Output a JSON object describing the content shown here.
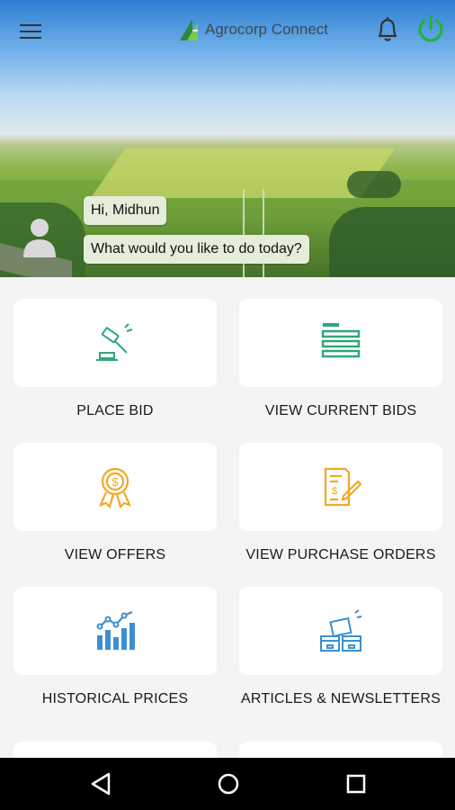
{
  "header": {
    "app_name": "Agrocorp Connect",
    "icons": [
      "menu-icon",
      "notification-bell-icon",
      "power-icon"
    ],
    "power_color": "#22b33a"
  },
  "greeting": {
    "hello": "Hi, Midhun",
    "question": "What would you like to do today?"
  },
  "menu": {
    "place_bid": "PLACE BID",
    "view_current_bids": "VIEW CURRENT BIDS",
    "view_offers": "VIEW OFFERS",
    "view_purchase_orders": "VIEW PURCHASE ORDERS",
    "historical_prices": "HISTORICAL PRICES",
    "articles_newsletters": "ARTICLES & NEWSLETTERS"
  },
  "colors": {
    "green_icon": "#2fa878",
    "orange_icon": "#f2a825",
    "blue_icon": "#3b8fd0"
  },
  "navbar": {
    "icons": [
      "back-icon",
      "home-icon",
      "recents-icon"
    ]
  }
}
